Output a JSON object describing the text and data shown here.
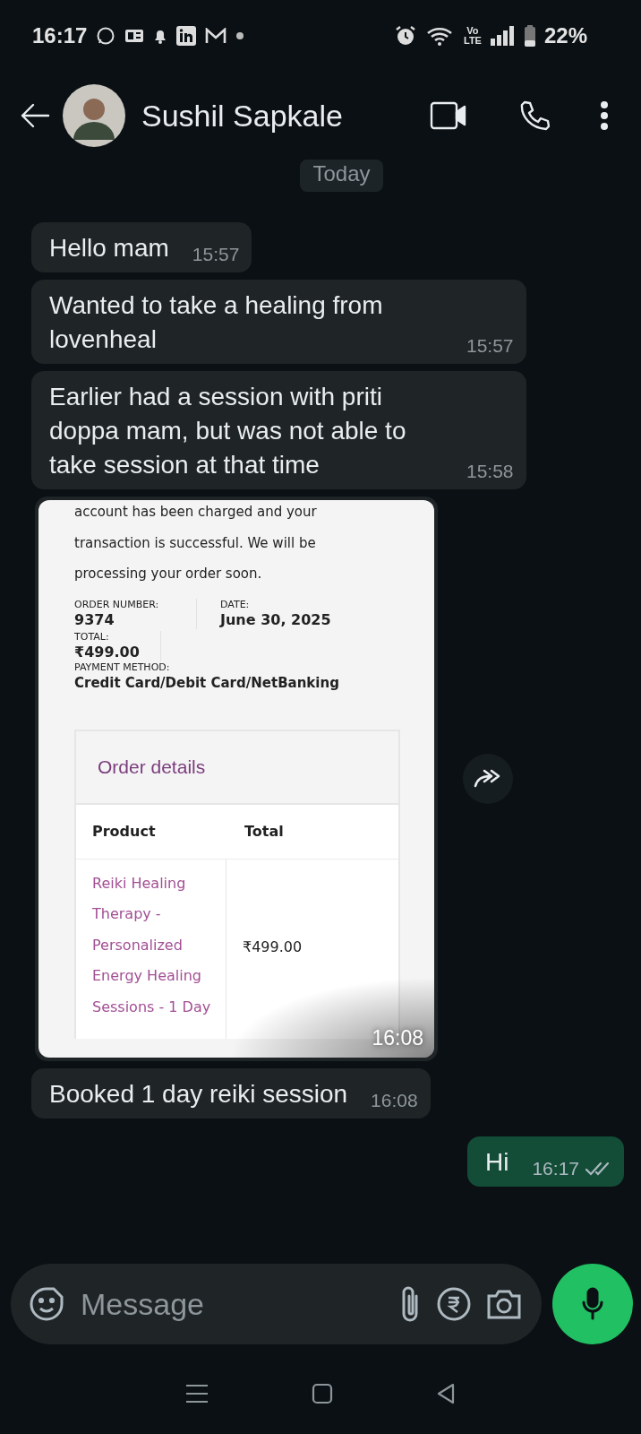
{
  "status_bar": {
    "time": "16:17",
    "network_top": "Vo",
    "network_bottom": "LTE",
    "battery": "22%"
  },
  "header": {
    "contact_name": "Sushil Sapkale"
  },
  "date_chip": "Today",
  "messages": [
    {
      "kind": "text",
      "outgoing": false,
      "text": "Hello mam",
      "time": "15:57"
    },
    {
      "kind": "text",
      "outgoing": false,
      "text": "Wanted to take a healing from lovenheal",
      "time": "15:57"
    },
    {
      "kind": "text",
      "outgoing": false,
      "text": "Earlier had a session with priti doppa mam, but was not able to take session at that time",
      "time": "15:58"
    },
    {
      "kind": "image",
      "outgoing": false,
      "time": "16:08",
      "receipt": {
        "intro": "account has been charged and your transaction is successful. We will be processing your order soon.",
        "fields": [
          {
            "label": "ORDER NUMBER:",
            "value": "9374"
          },
          {
            "label": "DATE:",
            "value": "June 30, 2025"
          },
          {
            "label": "TOTAL:",
            "value": "₹499.00"
          },
          {
            "label": "PAYMENT METHOD:",
            "value": "Credit Card/Debit Card/NetBanking"
          }
        ],
        "details_title": "Order details",
        "columns": [
          "Product",
          "Total"
        ],
        "rows": [
          {
            "product": "Reiki Healing Therapy - Personalized Energy Healing Sessions - 1 Day",
            "total": "₹499.00"
          }
        ]
      }
    },
    {
      "kind": "text",
      "outgoing": false,
      "text": "Booked 1 day reiki session",
      "time": "16:08"
    },
    {
      "kind": "text",
      "outgoing": true,
      "text": "Hi",
      "time": "16:17",
      "read": false
    }
  ],
  "composer": {
    "placeholder": "Message"
  }
}
